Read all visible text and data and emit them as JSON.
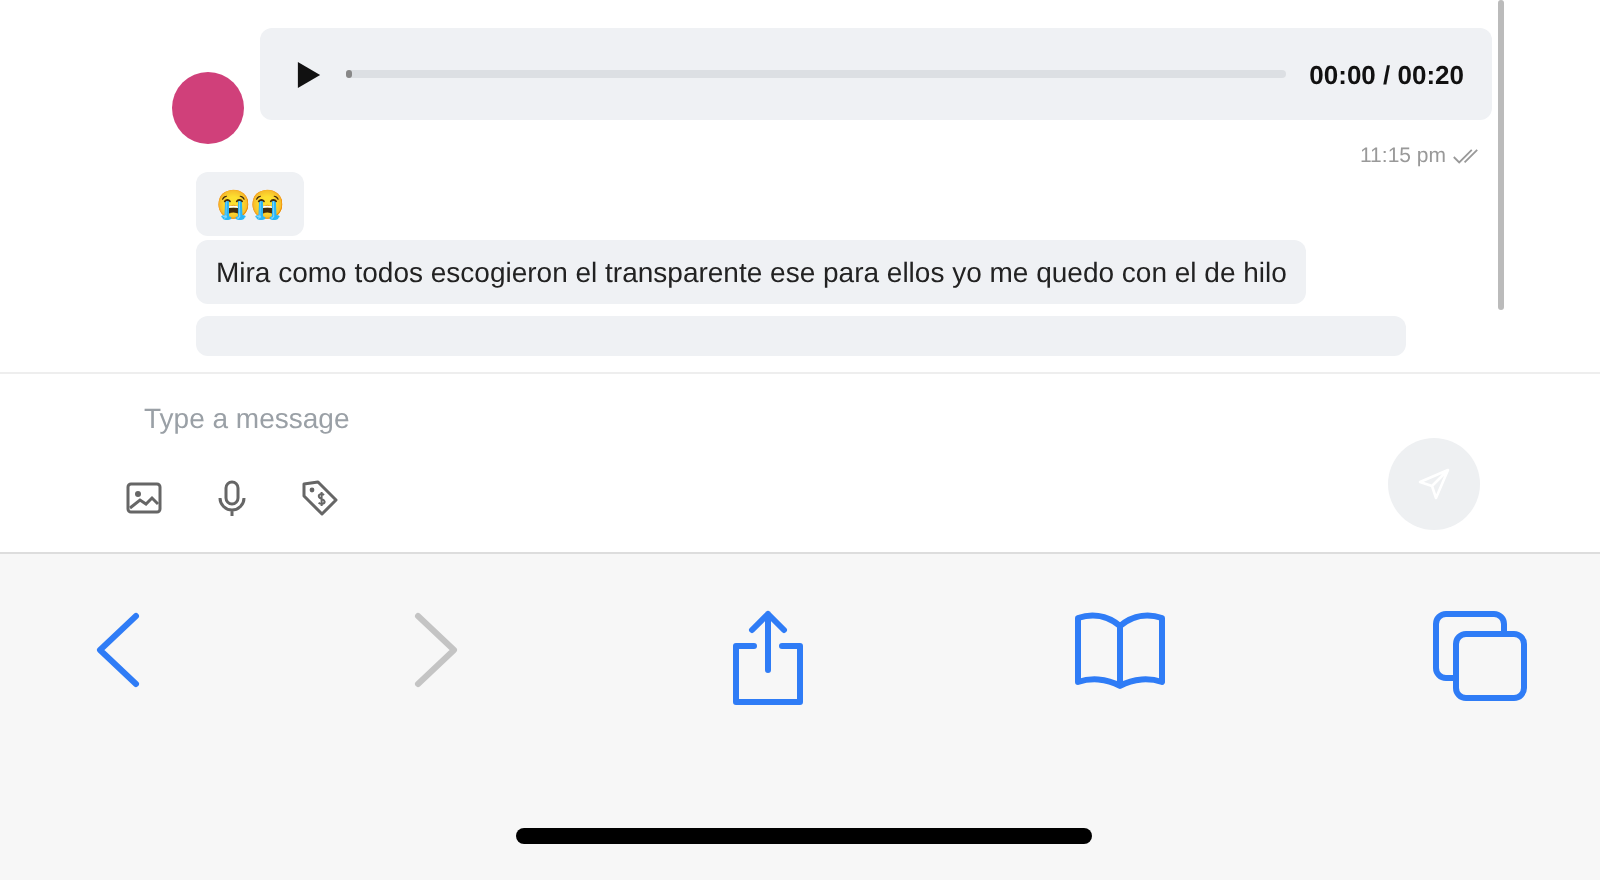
{
  "chat": {
    "messages": [
      {
        "kind": "audio",
        "progress": {
          "level": 0
        },
        "time_display": "00:00 / 00:20",
        "timestamp": "11:15 pm",
        "read": true
      },
      {
        "kind": "text",
        "text": "😭😭"
      },
      {
        "kind": "text",
        "text": "Mira como todos escogieron el transparente ese para ellos yo me quedo con el de hilo"
      }
    ]
  },
  "composer": {
    "placeholder": "Type a message",
    "send_disabled": true
  },
  "browser_toolbar": {
    "back_disabled": false,
    "forward_disabled": true
  }
}
